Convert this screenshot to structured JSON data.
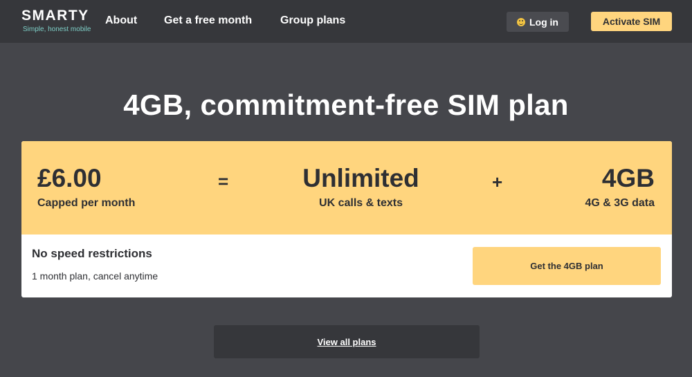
{
  "header": {
    "logo_word": "SMARTY",
    "logo_tagline": "Simple, honest mobile",
    "nav": [
      "About",
      "Get a free month",
      "Group plans"
    ],
    "login_label": "Log in",
    "login_icon": "smiley-icon",
    "activate_label": "Activate SIM"
  },
  "main": {
    "title": "4GB, commitment-free SIM plan"
  },
  "plan": {
    "price": "£6.00",
    "price_caption": "Capped per month",
    "equals": "=",
    "calls": "Unlimited",
    "calls_caption": "UK calls & texts",
    "plus": "+",
    "data": "4GB",
    "data_caption": "4G & 3G data",
    "feature_title": "No speed restrictions",
    "feature_sub": "1 month plan, cancel anytime",
    "cta_label": "Get the 4GB plan"
  },
  "footer": {
    "view_all_label": "View all plans"
  },
  "colors": {
    "page_bg": "#45464b",
    "header_bg": "#36373b",
    "accent_yellow": "#ffd57e",
    "tagline_teal": "#7ecfc7",
    "text_dark": "#2e2f33"
  }
}
